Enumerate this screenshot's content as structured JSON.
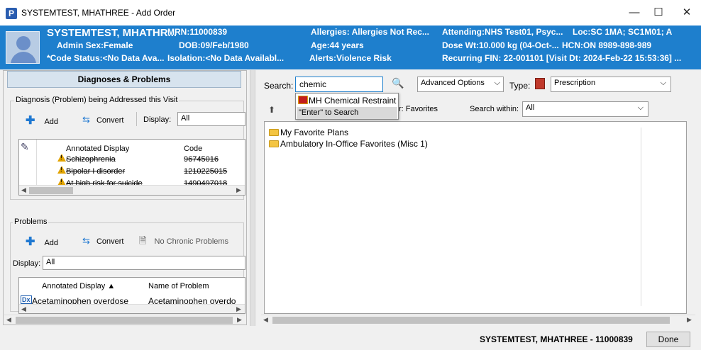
{
  "window": {
    "title": "SYSTEMTEST, MHATHREE - Add Order",
    "app_icon_letter": "P",
    "minimize": "—",
    "maximize": "☐",
    "close": "✕"
  },
  "banner": {
    "patient_name": "SYSTEMTEST, MHATHR...",
    "admin_sex": "Admin Sex:Female",
    "code_status": "*Code Status:<No Data Ava...",
    "mrn": "MRN:11000839",
    "dob": "DOB:09/Feb/1980",
    "isolation": "Isolation:<No Data Availabl...",
    "allergies": "Allergies: Allergies Not Rec...",
    "age": "Age:44 years",
    "alerts": "Alerts:Violence Risk",
    "attending": "Attending:NHS Test01, Psyc...",
    "loc": "Loc:SC 1MA; SC1M01; A",
    "dose_wt": "Dose Wt:10.000 kg (04-Oct-...",
    "hcn": "HCN:ON 8989-898-989",
    "recurring": "Recurring FIN: 22-001101 [Visit Dt: 2024-Feb-22 15:53:36] ..."
  },
  "left": {
    "header": "Diagnoses & Problems",
    "diag_group_label": "Diagnosis (Problem) being Addressed this Visit",
    "add": "Add",
    "convert": "Convert",
    "display_label": "Display:",
    "display_value": "All",
    "diag_columns": [
      "Annotated Display",
      "Code"
    ],
    "diag_rows": [
      {
        "name": "Schizophrenia",
        "code": "96745016"
      },
      {
        "name": "Bipolar I disorder",
        "code": "1210225015"
      },
      {
        "name": "At high risk for suicide",
        "code": "1490497018"
      }
    ],
    "problems_label": "Problems",
    "prob_add": "Add",
    "prob_convert": "Convert",
    "no_chronic": "No Chronic Problems",
    "prob_display_label": "Display:",
    "prob_display_value": "All",
    "prob_columns": [
      "Annotated Display ▲",
      "Name of Problem"
    ],
    "prob_rows": [
      {
        "badge": "Dx",
        "name": "Acetaminophen overdose",
        "problem": "Acetaminophen overdo"
      }
    ]
  },
  "right": {
    "search_label": "Search:",
    "search_value": "chemic",
    "advanced_options": "Advanced Options",
    "type_label": "Type:",
    "type_value": "Prescription",
    "favorites_suffix": "r: Favorites",
    "search_within_label": "Search within:",
    "search_within_value": "All",
    "suggestions": [
      "MH Chemical Restraint",
      "\"Enter\" to Search"
    ],
    "folders": [
      "My Favorite Plans",
      "Ambulatory In-Office Favorites (Misc 1)"
    ]
  },
  "footer": {
    "patient_id": "SYSTEMTEST, MHATHREE - 11000839",
    "done": "Done"
  },
  "colors": {
    "banner": "#1e7fcd",
    "header_bg": "#d7e3ee",
    "warning": "#e2a400",
    "folder": "#f4c542"
  }
}
